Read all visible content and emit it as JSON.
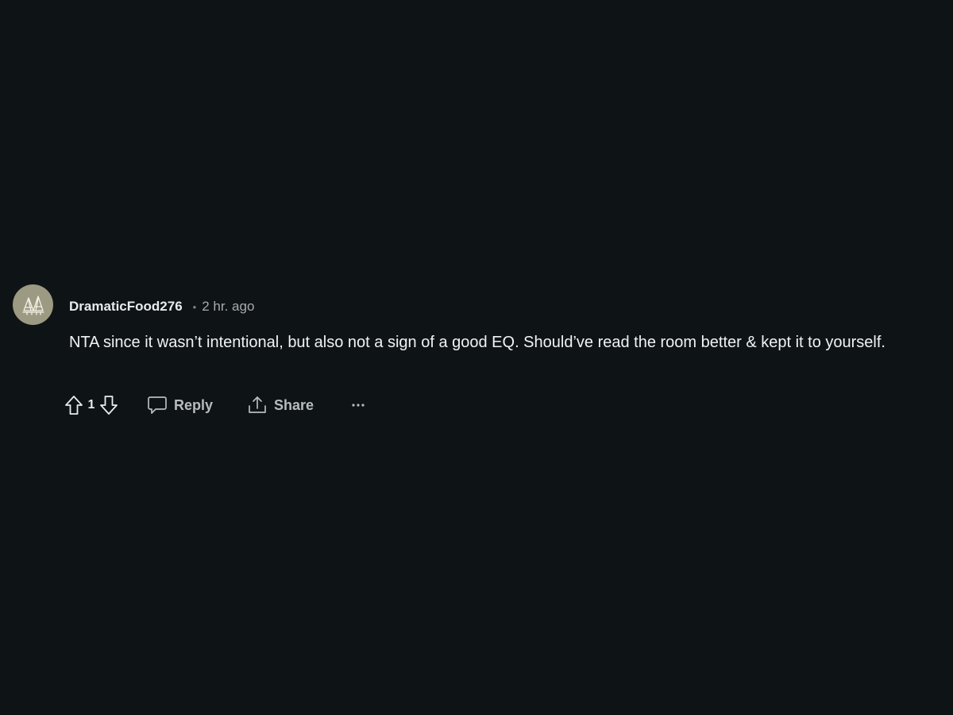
{
  "comment": {
    "author": "DramaticFood276",
    "separator": "•",
    "time": "2 hr. ago",
    "body": "NTA since it wasn’t intentional, but also not a sign of a good EQ. Should’ve read the room better & kept it to yourself.",
    "avatar_icon": "forest-tree-icon"
  },
  "actions": {
    "upvote_icon": "upvote-arrow-icon",
    "vote_count": "1",
    "downvote_icon": "downvote-arrow-icon",
    "reply_label": "Reply",
    "reply_icon": "comment-bubble-icon",
    "share_label": "Share",
    "share_icon": "share-upload-icon",
    "more_icon": "ellipsis-icon"
  },
  "colors": {
    "background": "#0e1416",
    "avatar_bg": "#9c9a82",
    "text_primary": "#f0f2f3",
    "text_muted": "#a8aaab"
  }
}
